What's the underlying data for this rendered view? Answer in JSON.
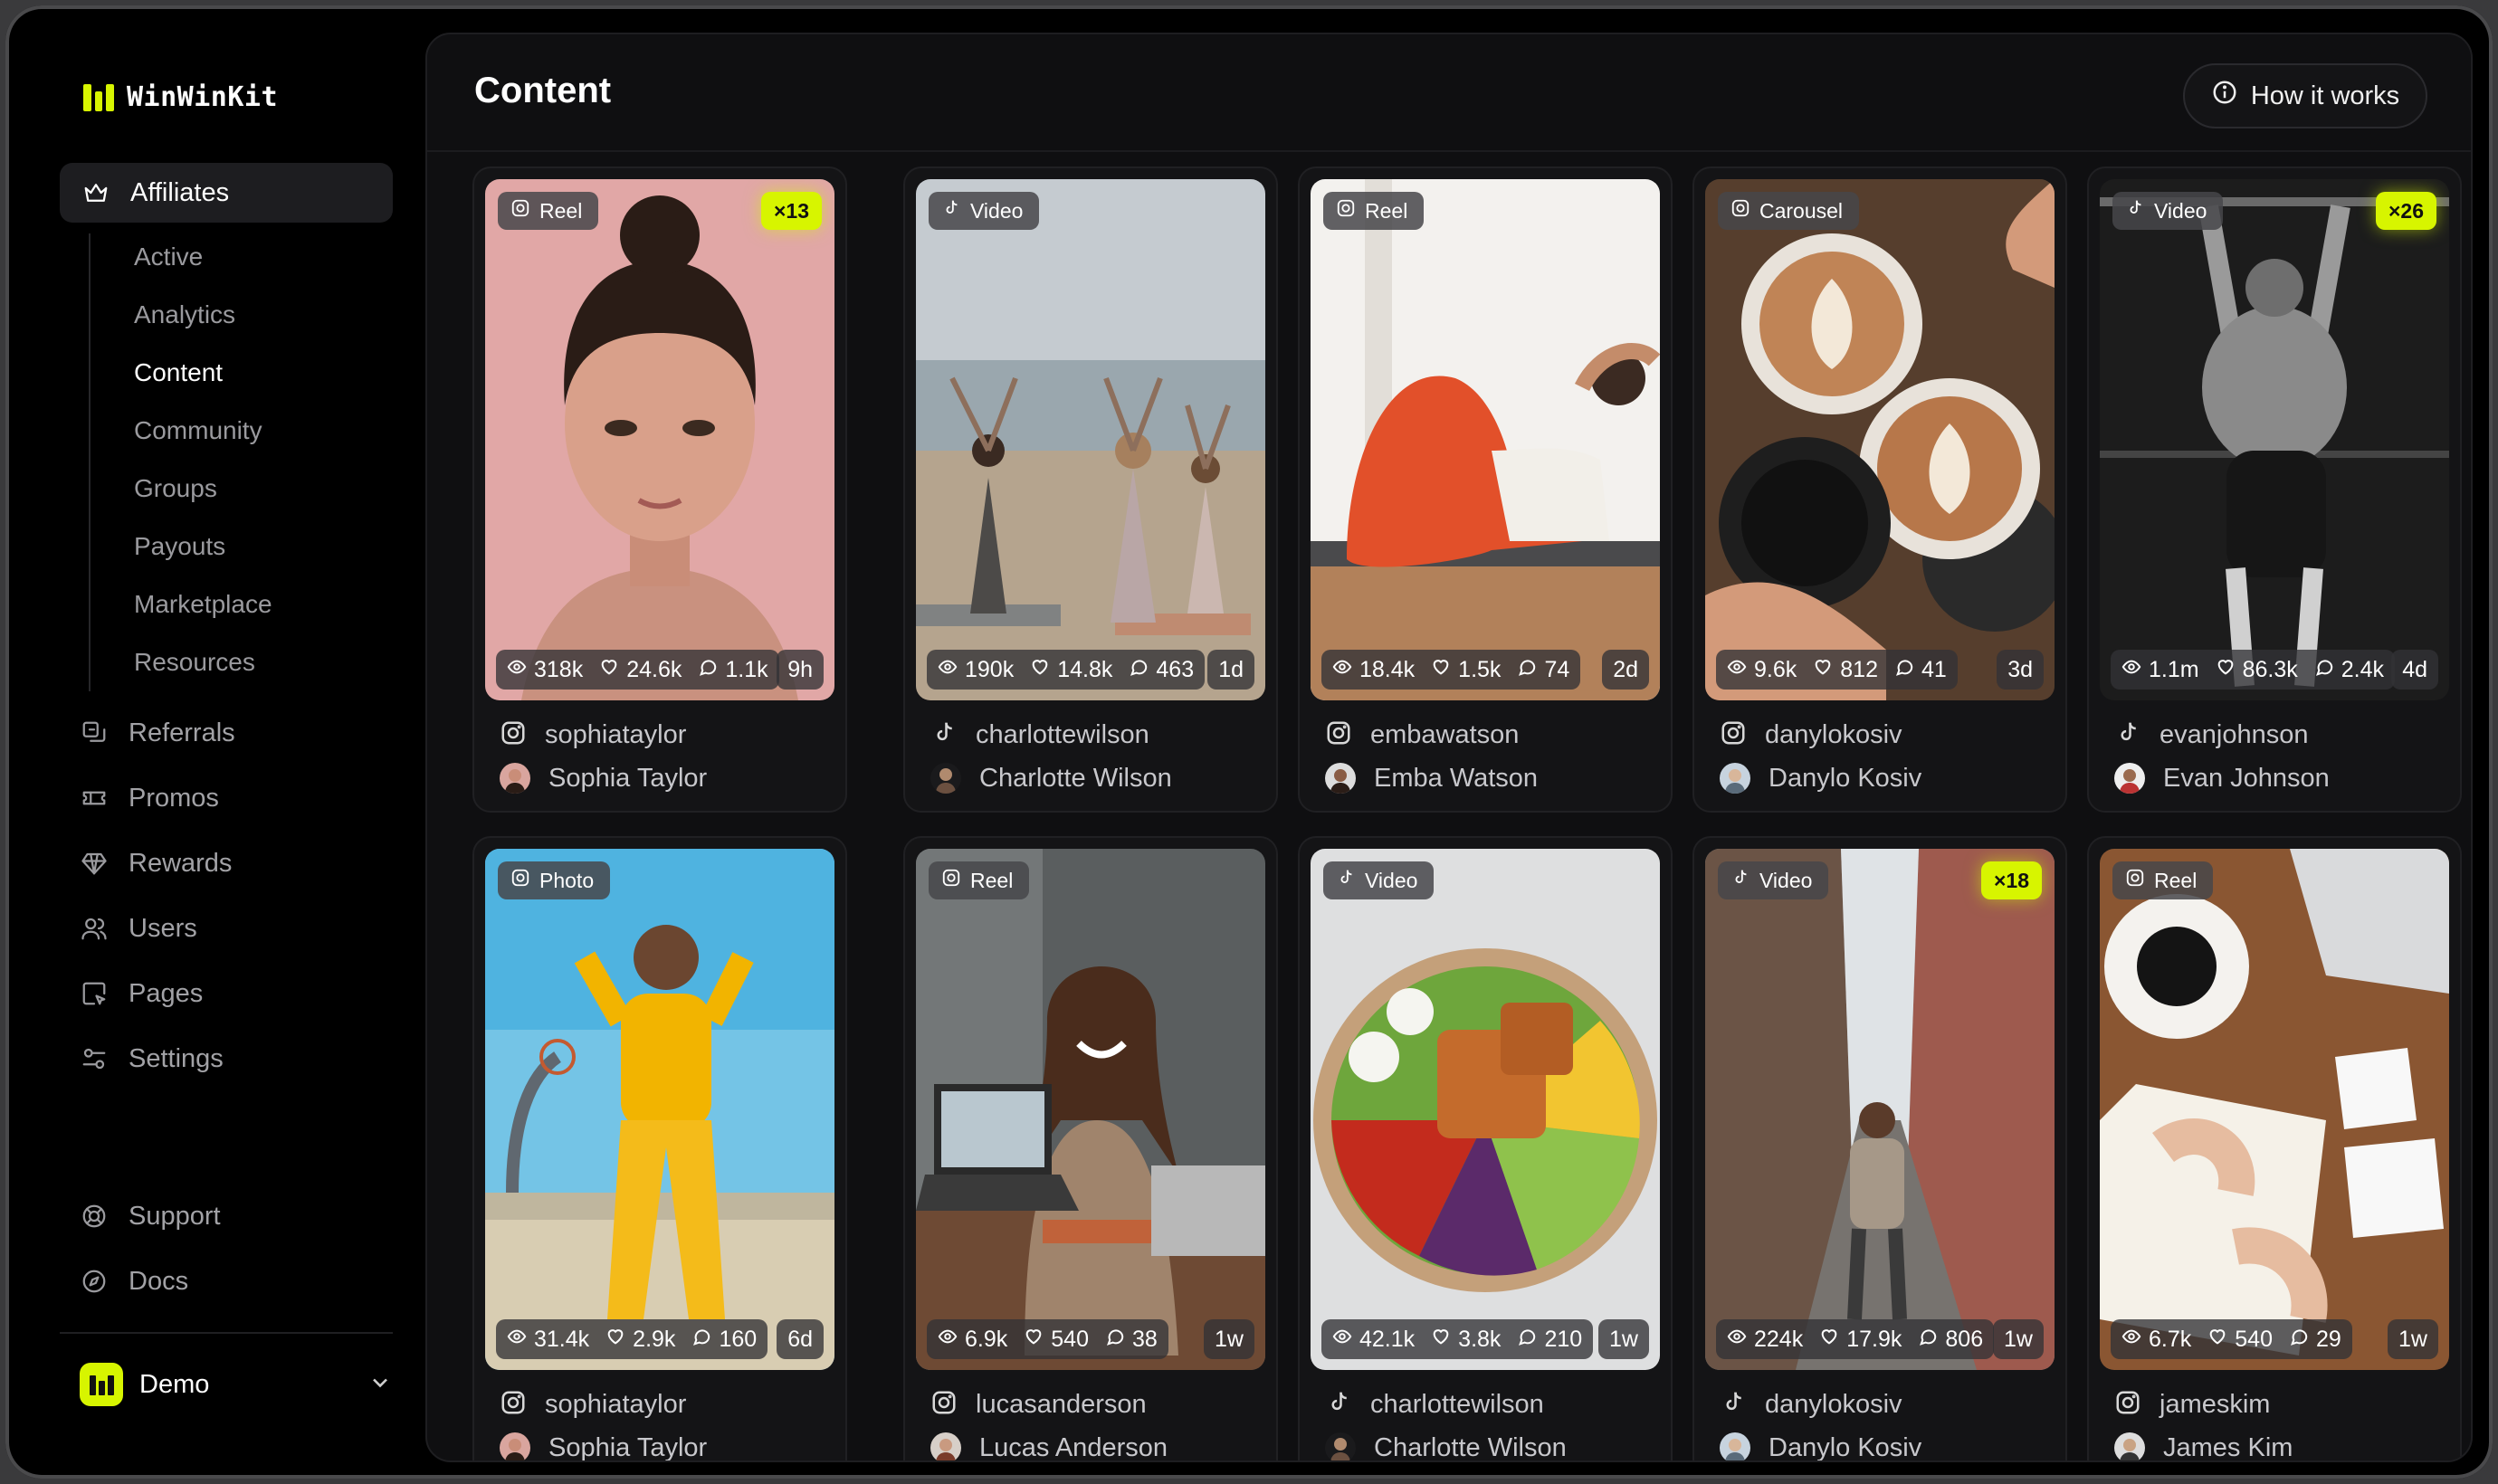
{
  "app": {
    "name": "WinWinKit"
  },
  "sidebar": {
    "active_section": "Affiliates",
    "sub_items": [
      "Active",
      "Analytics",
      "Content",
      "Community",
      "Groups",
      "Payouts",
      "Marketplace",
      "Resources"
    ],
    "current_sub_item": "Content",
    "items": [
      {
        "label": "Referrals",
        "icon": "referrals-icon"
      },
      {
        "label": "Promos",
        "icon": "ticket-icon"
      },
      {
        "label": "Rewards",
        "icon": "diamond-icon"
      },
      {
        "label": "Users",
        "icon": "users-icon"
      },
      {
        "label": "Pages",
        "icon": "page-cursor-icon"
      },
      {
        "label": "Settings",
        "icon": "sliders-icon"
      }
    ],
    "footer_items": [
      {
        "label": "Support",
        "icon": "lifebuoy-icon"
      },
      {
        "label": "Docs",
        "icon": "compass-icon"
      }
    ],
    "workspace": "Demo"
  },
  "main": {
    "title": "Content",
    "help_button": "How it works"
  },
  "cards": [
    {
      "type": "Reel",
      "network": "instagram",
      "multiplier": "×13",
      "views": "318k",
      "likes": "24.6k",
      "comments": "1.1k",
      "age": "9h",
      "handle": "sophiataylor",
      "name": "Sophia Taylor"
    },
    {
      "type": "Video",
      "network": "tiktok",
      "multiplier": "",
      "views": "190k",
      "likes": "14.8k",
      "comments": "463",
      "age": "1d",
      "handle": "charlottewilson",
      "name": "Charlotte Wilson"
    },
    {
      "type": "Reel",
      "network": "instagram",
      "multiplier": "",
      "views": "18.4k",
      "likes": "1.5k",
      "comments": "74",
      "age": "2d",
      "handle": "embawatson",
      "name": "Emba Watson"
    },
    {
      "type": "Carousel",
      "network": "instagram",
      "multiplier": "",
      "views": "9.6k",
      "likes": "812",
      "comments": "41",
      "age": "3d",
      "handle": "danylokosiv",
      "name": "Danylo Kosiv"
    },
    {
      "type": "Video",
      "network": "tiktok",
      "multiplier": "×26",
      "views": "1.1m",
      "likes": "86.3k",
      "comments": "2.4k",
      "age": "4d",
      "handle": "evanjohnson",
      "name": "Evan Johnson"
    },
    {
      "type": "Photo",
      "network": "instagram",
      "multiplier": "",
      "views": "31.4k",
      "likes": "2.9k",
      "comments": "160",
      "age": "6d",
      "handle": "sophiataylor",
      "name": "Sophia Taylor"
    },
    {
      "type": "Reel",
      "network": "instagram",
      "multiplier": "",
      "views": "6.9k",
      "likes": "540",
      "comments": "38",
      "age": "1w",
      "handle": "lucasanderson",
      "name": "Lucas Anderson"
    },
    {
      "type": "Video",
      "network": "tiktok",
      "multiplier": "",
      "views": "42.1k",
      "likes": "3.8k",
      "comments": "210",
      "age": "1w",
      "handle": "charlottewilson",
      "name": "Charlotte Wilson"
    },
    {
      "type": "Video",
      "network": "tiktok",
      "multiplier": "×18",
      "views": "224k",
      "likes": "17.9k",
      "comments": "806",
      "age": "1w",
      "handle": "danylokosiv",
      "name": "Danylo Kosiv"
    },
    {
      "type": "Reel",
      "network": "instagram",
      "multiplier": "",
      "views": "6.7k",
      "likes": "540",
      "comments": "29",
      "age": "1w",
      "handle": "jameskim",
      "name": "James Kim"
    }
  ],
  "colors": {
    "accent": "#d7f500",
    "background": "#000000",
    "panel": "#0f0f11"
  }
}
